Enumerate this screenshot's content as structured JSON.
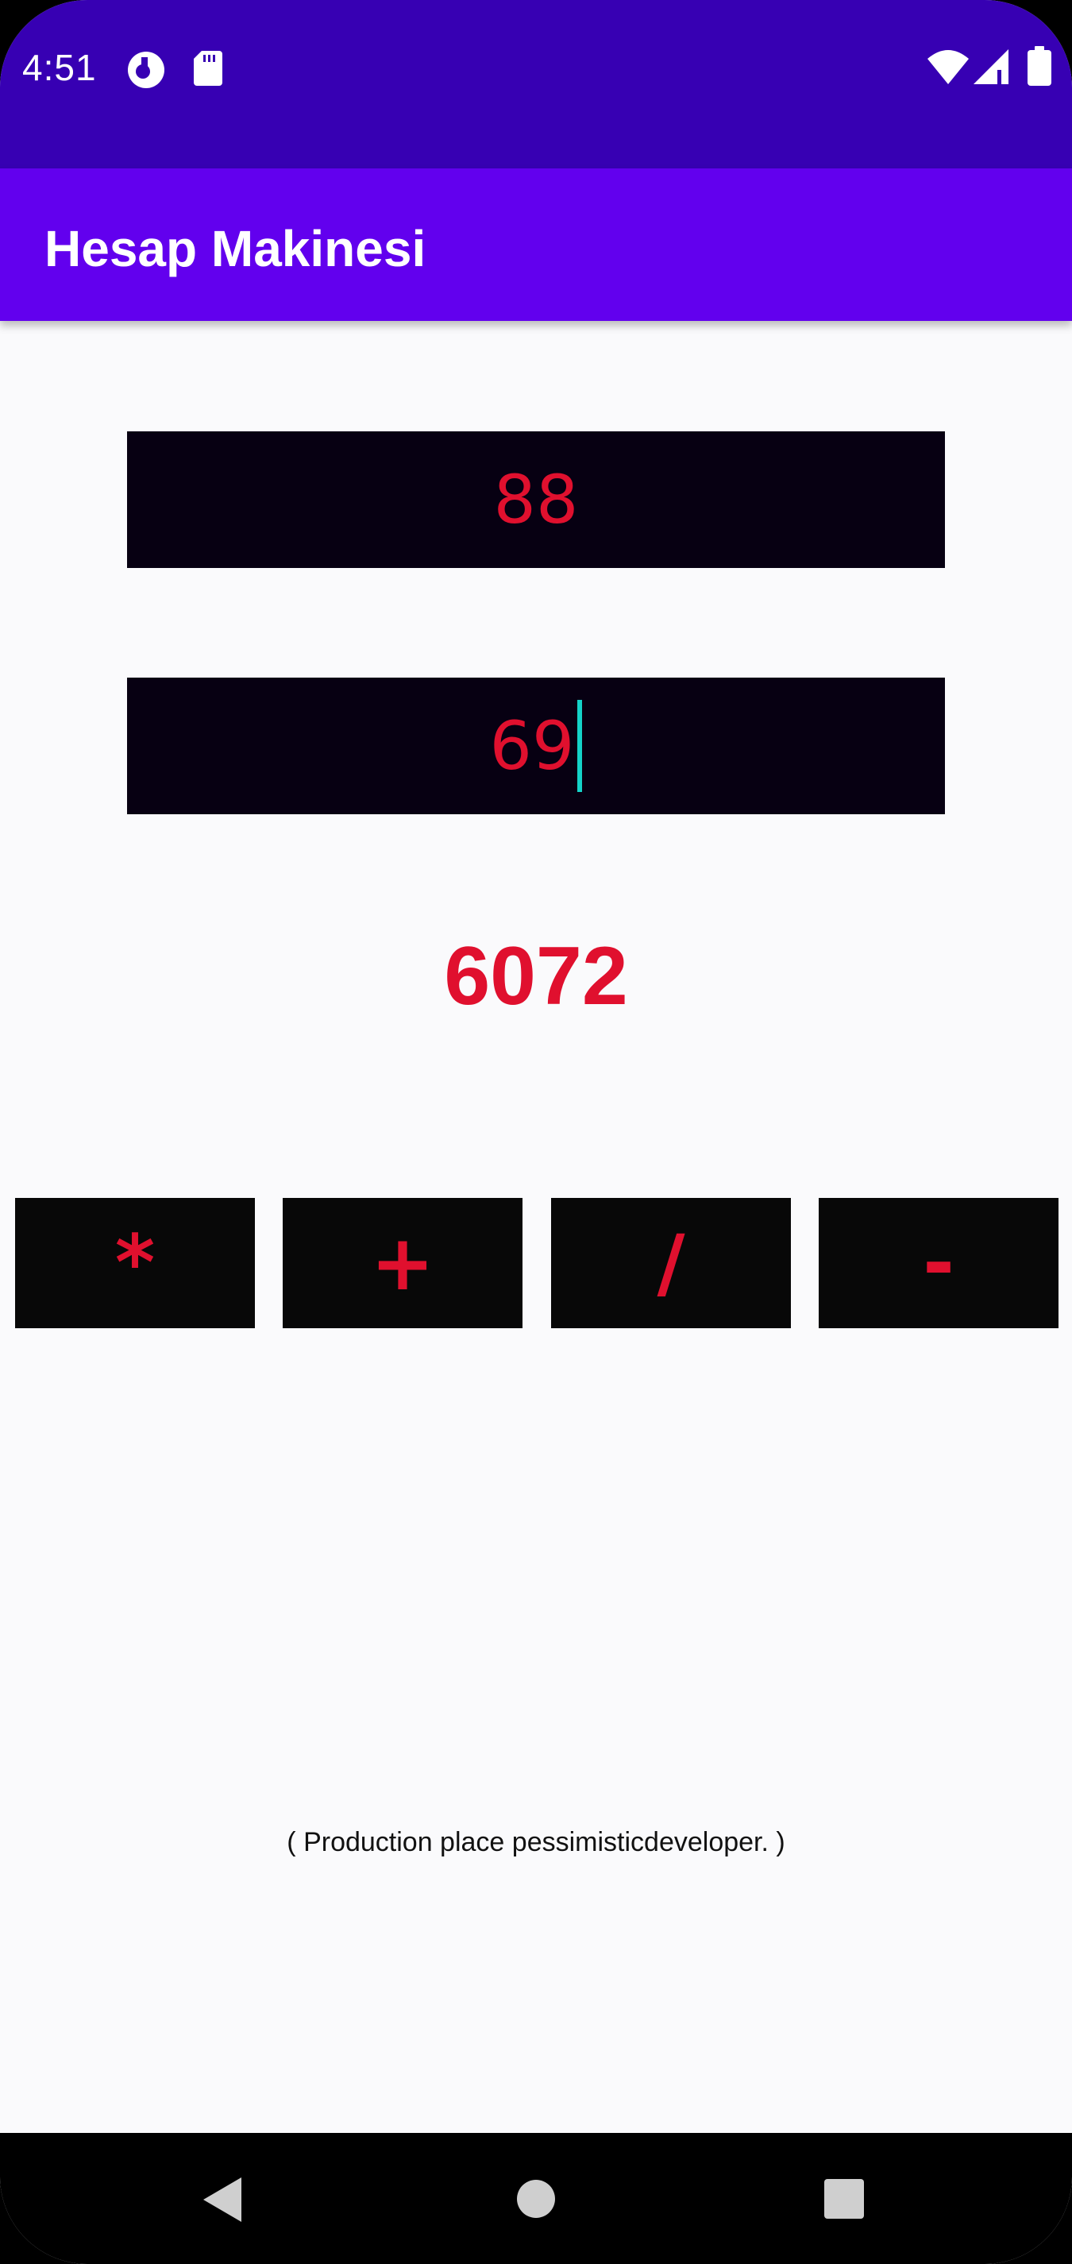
{
  "status_bar": {
    "time": "4:51",
    "left_icons": [
      "cast-icon",
      "sd-card-icon"
    ],
    "right_icons": [
      "wifi-icon",
      "signal-icon",
      "battery-icon"
    ],
    "background": "#3700b3"
  },
  "app_bar": {
    "title": "Hesap Makinesi",
    "background": "#6200ee"
  },
  "inputs": {
    "first_number": "88",
    "second_number": "69"
  },
  "result": {
    "value": "6072"
  },
  "operators": [
    {
      "label": "*"
    },
    {
      "label": "+"
    },
    {
      "label": "/"
    },
    {
      "label": "-"
    }
  ],
  "footer": {
    "note": "( Production place pessimisticdeveloper. )"
  },
  "nav_bar": {
    "buttons": [
      "back-icon",
      "home-icon",
      "recents-icon"
    ]
  },
  "colors": {
    "accent_red": "#e0102e",
    "field_bg": "#070012",
    "caret": "#14d2c8"
  }
}
